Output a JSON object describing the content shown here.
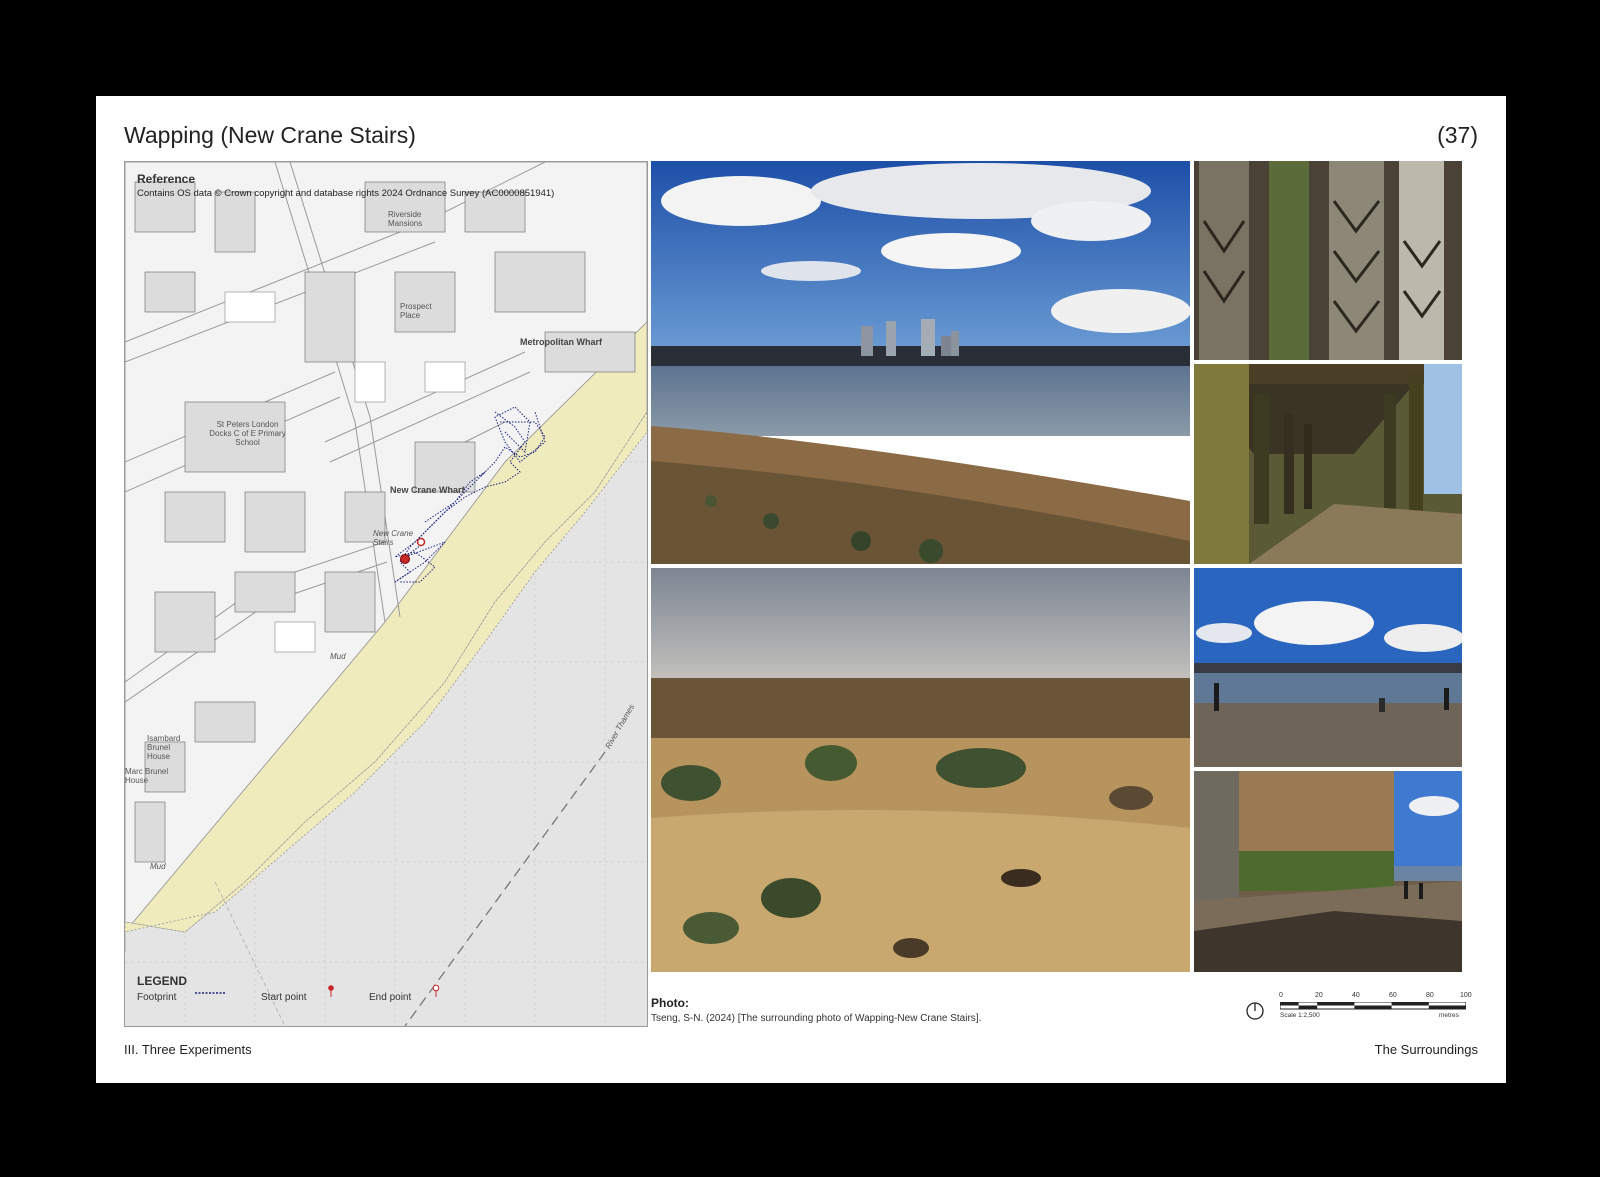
{
  "header": {
    "title": "Wapping (New Crane Stairs)",
    "page_number": "(37)"
  },
  "footer": {
    "left": "III. Three Experiments",
    "right": "The Surroundings"
  },
  "map": {
    "reference_title": "Reference",
    "reference_text": "Contains OS data © Crown copyright and database rights 2024 Ordnance Survey (AC0000851941)",
    "labels": {
      "metropolitan_wharf": "Metropolitan Wharf",
      "new_crane_wharf": "New Crane Wharf",
      "riverside_mansions": "Riverside Mansions",
      "prospect_place": "Prospect Place",
      "st_peters_school": "St Peters London Docks C of E Primary School",
      "new_crane_stairs": "New Crane Stairs",
      "marc_brunel_house": "Marc Brunel House",
      "brunel_house": "Isambard Brunel House",
      "river_thames": "River Thames",
      "mud1": "Mud",
      "mud2": "Mud"
    },
    "legend": {
      "title": "LEGEND",
      "footprint": "Footprint",
      "start_point": "Start point",
      "end_point": "End point"
    },
    "colors": {
      "foreshore": "#f0ebbd",
      "footprint": "#1a237e",
      "start": "#c62828",
      "end": "#c62828"
    }
  },
  "photos": [
    {
      "id": "skyline",
      "desc_icon": "photo"
    },
    {
      "id": "pillars",
      "desc_icon": "photo"
    },
    {
      "id": "under-pier",
      "desc_icon": "photo"
    },
    {
      "id": "foreshore",
      "desc_icon": "photo"
    },
    {
      "id": "beach-people",
      "desc_icon": "photo"
    },
    {
      "id": "wall-beach",
      "desc_icon": "photo"
    }
  ],
  "caption": {
    "title": "Photo:",
    "text": "Tseng, S-N. (2024) [The surrounding photo of Wapping-New Crane Stairs]."
  },
  "scale": {
    "ticks": [
      "0",
      "20",
      "40",
      "60",
      "80",
      "100"
    ],
    "scale_text": "Scale 1:2,500",
    "unit": "metres"
  }
}
